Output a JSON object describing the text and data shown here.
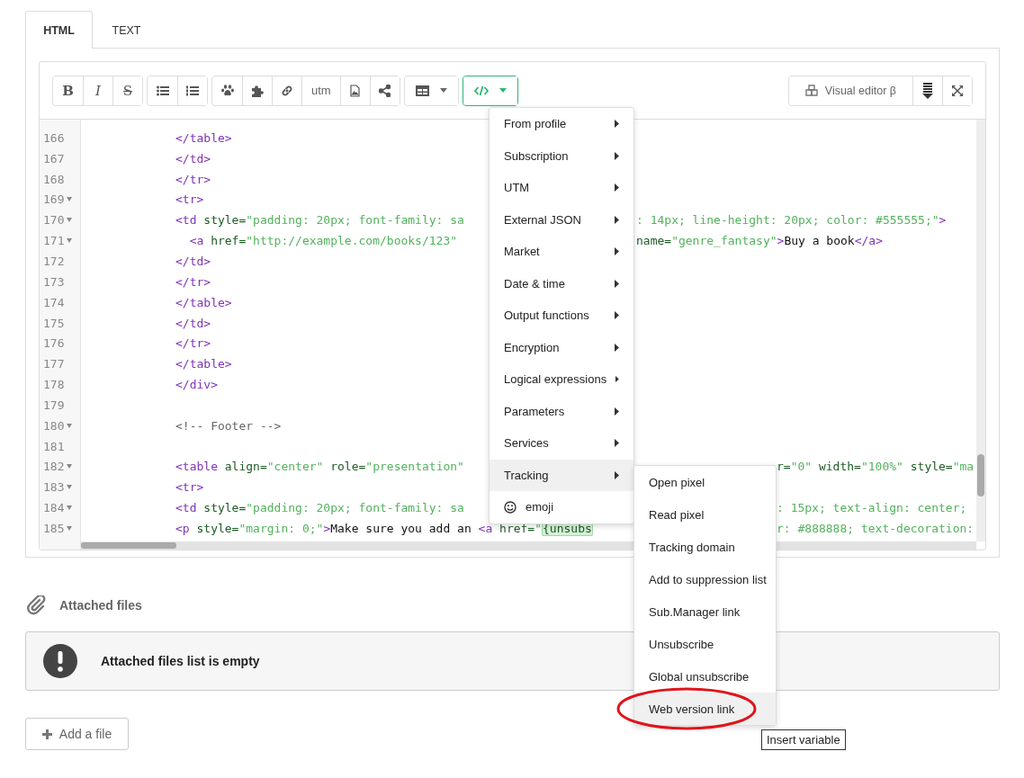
{
  "tabs": [
    {
      "label": "HTML",
      "selected": true
    },
    {
      "label": "TEXT",
      "selected": false
    }
  ],
  "toolbar": {
    "groups": [
      {
        "buttons": [
          {
            "kind": "bold",
            "label": "B"
          },
          {
            "kind": "italic",
            "label": "I"
          },
          {
            "kind": "strike",
            "label": "S"
          }
        ]
      },
      {
        "buttons": [
          {
            "kind": "bullet-list"
          },
          {
            "kind": "numbered-list"
          }
        ]
      },
      {
        "buttons": [
          {
            "kind": "paw"
          },
          {
            "kind": "puzzle"
          },
          {
            "kind": "link"
          },
          {
            "kind": "text",
            "label": "utm"
          },
          {
            "kind": "image-file"
          },
          {
            "kind": "share"
          }
        ]
      },
      {
        "buttons": [
          {
            "kind": "table",
            "dropdown": true,
            "active": false
          }
        ]
      },
      {
        "buttons": [
          {
            "kind": "code",
            "dropdown": true,
            "active": true
          }
        ]
      }
    ],
    "visual_editor": "Visual editor β"
  },
  "code": {
    "lines": [
      {
        "number": "166",
        "fold": false,
        "left": [
          {
            "kind": "tag",
            "text": "</table>"
          }
        ]
      },
      {
        "number": "167",
        "fold": false,
        "left": [
          {
            "kind": "tag",
            "text": "</td>"
          }
        ]
      },
      {
        "number": "168",
        "fold": false,
        "left": [
          {
            "kind": "tag",
            "text": "</tr>"
          }
        ]
      },
      {
        "number": "169",
        "fold": true,
        "left": [
          {
            "kind": "tag",
            "text": "<tr>"
          }
        ]
      },
      {
        "number": "170",
        "fold": true,
        "left": [
          {
            "kind": "tag",
            "text": "<td"
          },
          {
            "kind": "attr",
            "text": " style="
          },
          {
            "kind": "string",
            "text": "\"padding: 20px; font-family: sa"
          }
        ],
        "right": [
          {
            "kind": "string",
            "text": ": 14px; line-height: 20px; color: #555555;\""
          },
          {
            "kind": "tag",
            "text": ">"
          }
        ]
      },
      {
        "number": "171",
        "fold": true,
        "left": [
          {
            "kind": "tag",
            "text": "  <a"
          },
          {
            "kind": "attr",
            "text": " href="
          },
          {
            "kind": "string",
            "text": "\"http://example.com/books/123\""
          }
        ],
        "right": [
          {
            "kind": "attr",
            "text": "name="
          },
          {
            "kind": "string",
            "text": "\"genre_fantasy\""
          },
          {
            "kind": "tag",
            "text": ">"
          },
          {
            "kind": "text",
            "text": "Buy a book"
          },
          {
            "kind": "tag",
            "text": "</a>"
          }
        ]
      },
      {
        "number": "172",
        "fold": false,
        "left": [
          {
            "kind": "tag",
            "text": "</td>"
          }
        ]
      },
      {
        "number": "173",
        "fold": false,
        "left": [
          {
            "kind": "tag",
            "text": "</tr>"
          }
        ]
      },
      {
        "number": "174",
        "fold": false,
        "left": [
          {
            "kind": "tag",
            "text": "</table>"
          }
        ]
      },
      {
        "number": "175",
        "fold": false,
        "left": [
          {
            "kind": "tag",
            "text": "</td>"
          }
        ]
      },
      {
        "number": "176",
        "fold": false,
        "left": [
          {
            "kind": "tag",
            "text": "</tr>"
          }
        ]
      },
      {
        "number": "177",
        "fold": false,
        "left": [
          {
            "kind": "tag",
            "text": "</table>"
          }
        ]
      },
      {
        "number": "178",
        "fold": false,
        "left": [
          {
            "kind": "tag",
            "text": "</div>"
          }
        ]
      },
      {
        "number": "179",
        "fold": false
      },
      {
        "number": "180",
        "fold": true,
        "left": [
          {
            "kind": "comment",
            "text": "<!-- Footer -->"
          }
        ]
      },
      {
        "number": "181",
        "fold": false
      },
      {
        "number": "182",
        "fold": true,
        "left": [
          {
            "kind": "tag",
            "text": "<table"
          },
          {
            "kind": "attr",
            "text": " align="
          },
          {
            "kind": "string",
            "text": "\"center\""
          },
          {
            "kind": "attr",
            "text": " role="
          },
          {
            "kind": "string",
            "text": "\"presentation\""
          }
        ],
        "right": [
          {
            "kind": "attr",
            "text": "r="
          },
          {
            "kind": "string",
            "text": "\"0\""
          },
          {
            "kind": "attr",
            "text": " width="
          },
          {
            "kind": "string",
            "text": "\"100%\""
          },
          {
            "kind": "attr",
            "text": " style="
          },
          {
            "kind": "string",
            "text": "\"ma"
          }
        ]
      },
      {
        "number": "183",
        "fold": true,
        "left": [
          {
            "kind": "tag",
            "text": "<tr>"
          }
        ]
      },
      {
        "number": "184",
        "fold": true,
        "left": [
          {
            "kind": "tag",
            "text": "<td"
          },
          {
            "kind": "attr",
            "text": " style="
          },
          {
            "kind": "string",
            "text": "\"padding: 20px; font-family: sa"
          }
        ],
        "right": [
          {
            "kind": "string",
            "text": ": 15px; text-align: center;"
          }
        ]
      },
      {
        "number": "185",
        "fold": true,
        "left": [
          {
            "kind": "tag",
            "text": "<p"
          },
          {
            "kind": "attr",
            "text": " style="
          },
          {
            "kind": "string",
            "text": "\"margin: 0;\""
          },
          {
            "kind": "tag",
            "text": ">"
          },
          {
            "kind": "text",
            "text": "Make sure you add an "
          },
          {
            "kind": "tag",
            "text": "<a"
          },
          {
            "kind": "attr",
            "text": " href="
          },
          {
            "kind": "string",
            "text": "\""
          },
          {
            "kind": "var",
            "text": "{unsubs"
          }
        ],
        "right": [
          {
            "kind": "string",
            "text": "r: #888888; text-decoration:"
          }
        ]
      }
    ]
  },
  "menu": {
    "items": [
      {
        "kind": "submenu",
        "label": "From profile",
        "selected": false
      },
      {
        "kind": "submenu",
        "label": "Subscription",
        "selected": false
      },
      {
        "kind": "submenu",
        "label": "UTM",
        "selected": false
      },
      {
        "kind": "submenu",
        "label": "External JSON",
        "selected": false
      },
      {
        "kind": "submenu",
        "label": "Market",
        "selected": false
      },
      {
        "kind": "submenu",
        "label": "Date & time",
        "selected": false
      },
      {
        "kind": "submenu",
        "label": "Output functions",
        "selected": false
      },
      {
        "kind": "submenu",
        "label": "Encryption",
        "selected": false
      },
      {
        "kind": "submenu",
        "label": "Logical expressions",
        "selected": false
      },
      {
        "kind": "submenu",
        "label": "Parameters",
        "selected": false
      },
      {
        "kind": "submenu",
        "label": "Services",
        "selected": false
      },
      {
        "kind": "submenu",
        "label": "Tracking",
        "selected": true
      },
      {
        "kind": "emoji",
        "label": "emoji",
        "selected": false
      }
    ]
  },
  "submenu": {
    "items": [
      {
        "label": "Open pixel",
        "selected": false,
        "circled": false
      },
      {
        "label": "Read pixel",
        "selected": false,
        "circled": false
      },
      {
        "label": "Tracking domain",
        "selected": false,
        "circled": false
      },
      {
        "label": "Add to suppression list",
        "selected": false,
        "circled": false
      },
      {
        "label": "Sub.Manager link",
        "selected": false,
        "circled": false
      },
      {
        "label": "Unsubscribe",
        "selected": false,
        "circled": false
      },
      {
        "label": "Global unsubscribe",
        "selected": false,
        "circled": false
      },
      {
        "label": "Web version link",
        "selected": true,
        "circled": true
      }
    ]
  },
  "tooltip": "Insert variable",
  "attachments": {
    "title": "Attached files",
    "notice": "Attached files list is empty",
    "add_button": "Add a file"
  }
}
